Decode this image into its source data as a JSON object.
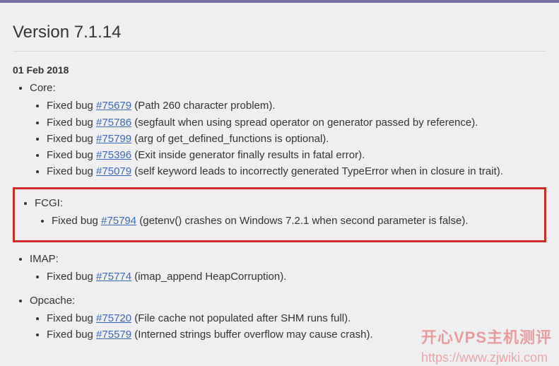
{
  "title": "Version 7.1.14",
  "date": "01 Feb 2018",
  "sections": {
    "core": {
      "label": "Core:",
      "items": [
        {
          "prefix": "Fixed bug ",
          "bug": "#75679",
          "desc": " (Path 260 character problem)."
        },
        {
          "prefix": "Fixed bug ",
          "bug": "#75786",
          "desc": " (segfault when using spread operator on generator passed by reference)."
        },
        {
          "prefix": "Fixed bug ",
          "bug": "#75799",
          "desc": " (arg of get_defined_functions is optional)."
        },
        {
          "prefix": "Fixed bug ",
          "bug": "#75396",
          "desc": " (Exit inside generator finally results in fatal error)."
        },
        {
          "prefix": "Fixed bug ",
          "bug": "#75079",
          "desc": " (self keyword leads to incorrectly generated TypeError when in closure in trait)."
        }
      ]
    },
    "fcgi": {
      "label": "FCGI:",
      "items": [
        {
          "prefix": "Fixed bug ",
          "bug": "#75794",
          "desc": " (getenv() crashes on Windows 7.2.1 when second parameter is false)."
        }
      ]
    },
    "imap": {
      "label": "IMAP:",
      "items": [
        {
          "prefix": "Fixed bug ",
          "bug": "#75774",
          "desc": " (imap_append HeapCorruption)."
        }
      ]
    },
    "opcache": {
      "label": "Opcache:",
      "items": [
        {
          "prefix": "Fixed bug ",
          "bug": "#75720",
          "desc": " (File cache not populated after SHM runs full)."
        },
        {
          "prefix": "Fixed bug ",
          "bug": "#75579",
          "desc": " (Interned strings buffer overflow may cause crash)."
        }
      ]
    }
  },
  "watermark": {
    "cn": "开心VPS主机测评",
    "url": "https://www.zjwiki.com"
  }
}
